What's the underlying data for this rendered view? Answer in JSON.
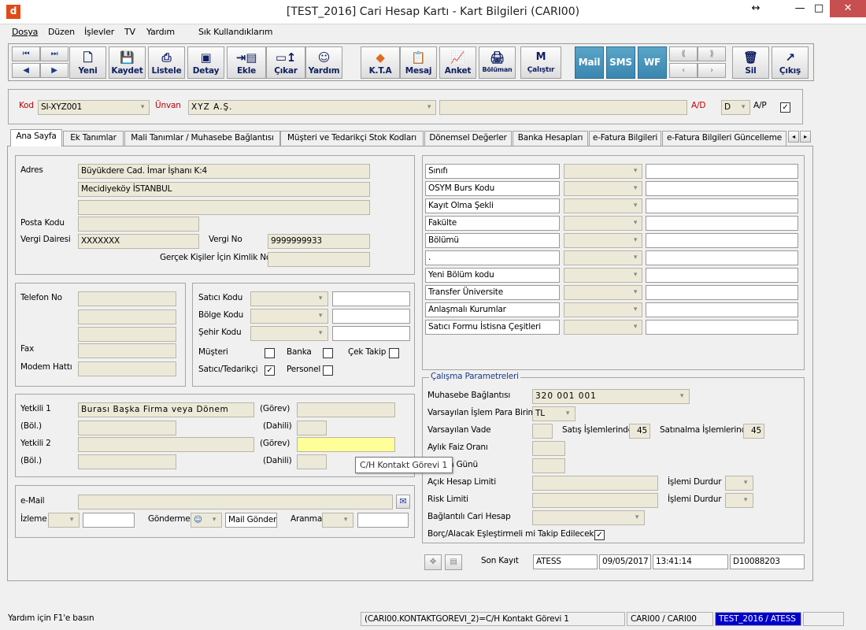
{
  "window": {
    "title": "[TEST_2016] Cari Hesap Kartı - Kart Bilgileri (CARI00)",
    "app_icon": "d",
    "resize_glyph": "↔",
    "minimize": "—",
    "maximize": "□",
    "close": "✕"
  },
  "menu": [
    "Dosya",
    "Düzen",
    "İşlevler",
    "TV",
    "Yardım",
    "Sık Kullandıklarım"
  ],
  "toolbar": {
    "yeni": "Yeni",
    "kaydet": "Kaydet",
    "listele": "Listele",
    "detay": "Detay",
    "ekle": "Ekle",
    "cikar": "Çıkar",
    "yardim": "Yardım",
    "kta": "K.T.A",
    "mesaj": "Mesaj",
    "anket": "Anket",
    "bolumau": "Bölüman",
    "calistir": "Çalıştır",
    "mail": "Mail",
    "sms": "SMS",
    "wf": "WF",
    "sil": "Sil",
    "cikis": "Çıkış"
  },
  "header": {
    "kod_label": "Kod",
    "kod_value": "SI-XYZ001",
    "unvan_label": "Ünvan",
    "unvan_value": "XYZ A.Ş.",
    "ad_label": "A/D",
    "ad_value": "D",
    "ap_label": "A/P",
    "ap_checked": "✓"
  },
  "tabs": [
    "Ana Sayfa",
    "Ek Tanımlar",
    "Mali Tanımlar / Muhasebe Bağlantısı",
    "Müşteri ve Tedarikçi Stok Kodları",
    "Dönemsel Değerler",
    "Banka Hesapları",
    "e-Fatura Bilgileri",
    "e-Fatura Bilgileri Güncelleme"
  ],
  "address": {
    "adres_label": "Adres",
    "line1": "Büyükdere Cad. İmar İşhanı K:4",
    "line2": "Mecidiyeköy İSTANBUL",
    "posta_label": "Posta Kodu",
    "vd_label": "Vergi Dairesi",
    "vd_value": "XXXXXXX",
    "vno_label": "Vergi No",
    "vno_value": "9999999933",
    "tckn_label": "Gerçek Kişiler İçin Kimlik No"
  },
  "contact": {
    "tel_label": "Telefon No",
    "fax_label": "Fax",
    "modem_label": "Modem Hattı"
  },
  "codes": {
    "satici_label": "Satıcı Kodu",
    "bolge_label": "Bölge Kodu",
    "sehir_label": "Şehir Kodu",
    "musteri_label": "Müşteri",
    "banka_label": "Banka",
    "cek_label": "Çek Takip",
    "satted_label": "Satıcı/Tedarikçi",
    "satted_checked": "✓",
    "personel_label": "Personel"
  },
  "yetkili": {
    "y1_label": "Yetkili 1",
    "y1_value": "Burası Başka Firma veya Dönem",
    "gorev_label": "(Görev)",
    "bol_label": "(Böl.)",
    "dahili_label": "(Dahili)",
    "y2_label": "Yetkili 2"
  },
  "tooltip": "C/H Kontakt Görevi 1",
  "mail": {
    "email_label": "e-Mail",
    "izleme_label": "İzleme",
    "gonderme_label": "Gönderme",
    "mail_gonder": "Mail Gönderi",
    "aranma_label": "Aranma"
  },
  "right_list": [
    "Sınıfı",
    "OSYM Burs Kodu",
    "Kayıt Olma Şekli",
    "Fakülte",
    "Bölümü",
    ".",
    "Yeni Bölüm kodu",
    "Transfer Üniversite",
    "Anlaşmalı Kurumlar",
    "Satıcı Formu İstisna Çeşitleri"
  ],
  "params": {
    "legend": "Çalışma Parametreleri",
    "muh_label": "Muhasebe Bağlantısı",
    "muh_value": "320 001 001",
    "para_label": "Varsayılan İşlem Para Birimi",
    "para_value": "TL",
    "vade_label": "Varsayılan Vade",
    "satis_label": "Satış İşlemlerinde",
    "satis_value": "45",
    "satinalma_label": "Satınalma İşlemlerinde",
    "satinalma_value": "45",
    "faiz_label": "Aylık Faiz Oranı",
    "gunu_label": "n Günü",
    "acik_label": "Açık Hesap Limiti",
    "durdur_label": "İşlemi Durdur",
    "risk_label": "Risk Limiti",
    "bagli_label": "Bağlantılı Cari Hesap",
    "borc_label": "Borç/Alacak Eşleştirmeli mi Takip Edilecek?",
    "borc_checked": "✓"
  },
  "sonkayit": {
    "label": "Son Kayıt",
    "user": "ATESS",
    "date": "09/05/2017",
    "time": "13:41:14",
    "id": "D10088203"
  },
  "status": {
    "help": "Yardım için F1'e basın",
    "field": "(CARI00.KONTAKTGOREVI_2)=C/H Kontakt Görevi 1",
    "table": "CARI00 / CARI00",
    "db": "TEST_2016 / ATESS"
  }
}
